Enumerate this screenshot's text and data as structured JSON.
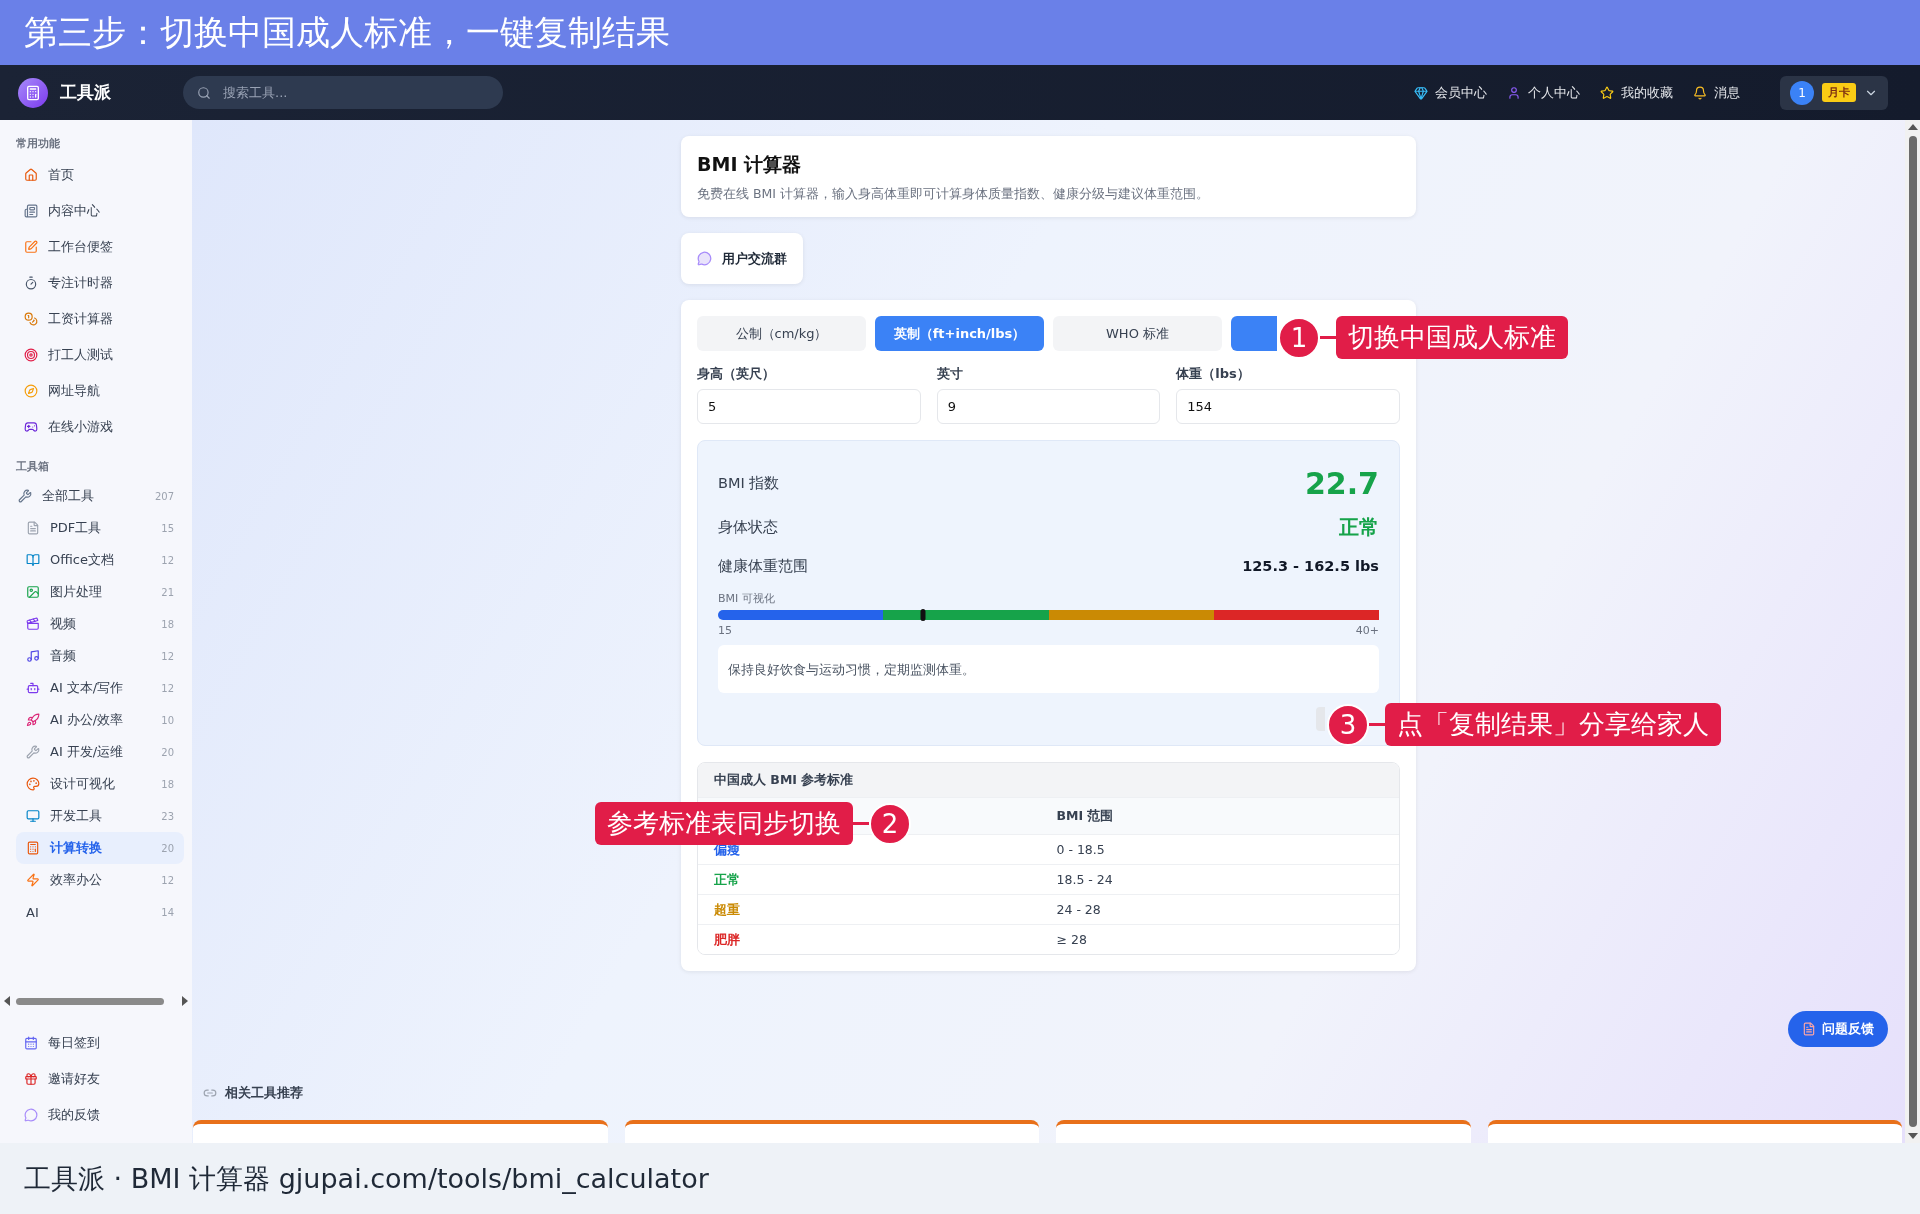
{
  "banner": {
    "title": "第三步：切换中国成人标准，一键复制结果"
  },
  "navbar": {
    "logo": "工具派",
    "search": {
      "placeholder": "搜索工具..."
    },
    "links": [
      {
        "label": "会员中心"
      },
      {
        "label": "个人中心"
      },
      {
        "label": "我的收藏"
      },
      {
        "label": "消息"
      }
    ],
    "user": {
      "avatar": "1",
      "badge": "月卡"
    }
  },
  "sidebar": {
    "sections": [
      {
        "title": "常用功能",
        "items": [
          {
            "label": "首页",
            "selected": false
          },
          {
            "label": "内容中心",
            "selected": false
          },
          {
            "label": "工作台便签",
            "selected": false
          },
          {
            "label": "专注计时器",
            "selected": false
          },
          {
            "label": "工资计算器",
            "selected": false
          },
          {
            "label": "打工人测试",
            "selected": false
          },
          {
            "label": "网址导航",
            "selected": false
          },
          {
            "label": "在线小游戏",
            "selected": false
          }
        ]
      },
      {
        "title": "工具箱",
        "items": [
          {
            "label": "全部工具",
            "count": "207",
            "selected": false,
            "children": [
              {
                "label": "PDF工具",
                "count": "15",
                "selected": false
              },
              {
                "label": "Office文档",
                "count": "12",
                "selected": false
              },
              {
                "label": "图片处理",
                "count": "21",
                "selected": false
              },
              {
                "label": "视频",
                "count": "18",
                "selected": false
              },
              {
                "label": "音频",
                "count": "12",
                "selected": false
              },
              {
                "label": "AI 文本/写作",
                "count": "12",
                "selected": false
              },
              {
                "label": "AI 办公/效率",
                "count": "10",
                "selected": false
              },
              {
                "label": "AI 开发/运维",
                "count": "20",
                "selected": false
              },
              {
                "label": "设计可视化",
                "count": "18",
                "selected": false
              },
              {
                "label": "开发工具",
                "count": "23",
                "selected": false
              },
              {
                "label": "计算转换",
                "count": "20",
                "selected": true
              },
              {
                "label": "效率办公",
                "count": "12",
                "selected": false
              },
              {
                "label": "AI",
                "count": "14",
                "selected": false
              }
            ]
          }
        ]
      }
    ],
    "footer_items": [
      {
        "label": "每日签到"
      },
      {
        "label": "邀请好友"
      },
      {
        "label": "我的反馈"
      }
    ]
  },
  "header": {
    "title": "BMI 计算器",
    "description": "免费在线 BMI 计算器，输入身高体重即可计算身体质量指数、健康分级与建议体重范围。"
  },
  "community_button": {
    "label": "用户交流群"
  },
  "calculator": {
    "unit_tabs": [
      {
        "label": "公制（cm/kg）",
        "selected": false
      },
      {
        "label": "英制（ft+inch/lbs）",
        "selected": true
      }
    ],
    "standard_tabs": [
      {
        "label": "WHO 标准",
        "selected": false
      },
      {
        "selected": true
      }
    ],
    "fields": [
      {
        "label": "身高（英尺）",
        "value": "5"
      },
      {
        "label": "英寸",
        "value": "9"
      },
      {
        "label": "体重（lbs）",
        "value": "154"
      }
    ],
    "result": {
      "rows": [
        {
          "kind": "index",
          "label": "BMI 指数",
          "value": "22.7"
        },
        {
          "kind": "status",
          "label": "身体状态",
          "value": "正常"
        },
        {
          "kind": "range",
          "label": "健康体重范围",
          "value": "125.3 - 162.5 lbs"
        }
      ],
      "scale": {
        "title": "BMI 可视化",
        "min_label": "15",
        "max_label": "40+",
        "level": 0.31,
        "segments": [
          {
            "color": "#2563eb"
          },
          {
            "color": "#16a34a"
          },
          {
            "color": "#ca8a04"
          },
          {
            "color": "#dc2626"
          }
        ]
      },
      "advice": "保持良好饮食与运动习惯，定期监测体重。"
    }
  },
  "reference_table": {
    "title": "中国成人 BMI 参考标准",
    "range_header": "BMI 范围",
    "rows": [
      {
        "category": "偏瘦",
        "range": "0 - 18.5",
        "color": "#2563eb"
      },
      {
        "category": "正常",
        "range": "18.5 - 24",
        "color": "#16a34a"
      },
      {
        "category": "超重",
        "range": "24 - 28",
        "color": "#ca8a04"
      },
      {
        "category": "肥胖",
        "range": "≥ 28",
        "color": "#dc2626"
      }
    ]
  },
  "feedback_button": {
    "label": "问题反馈"
  },
  "related": {
    "title": "相关工具推荐",
    "cards": [
      {
        "kind": "card"
      },
      {
        "kind": "card"
      },
      {
        "kind": "card"
      },
      {
        "kind": "card"
      }
    ]
  },
  "annotations": [
    {
      "number": "1",
      "text": "切换中国成人标准"
    },
    {
      "number": "2",
      "text": "参考标准表同步切换"
    },
    {
      "number": "3",
      "text": "点「复制结果」分享给家人"
    }
  ],
  "caption": "工具派 · BMI 计算器 gjupai.com/tools/bmi_calculator"
}
